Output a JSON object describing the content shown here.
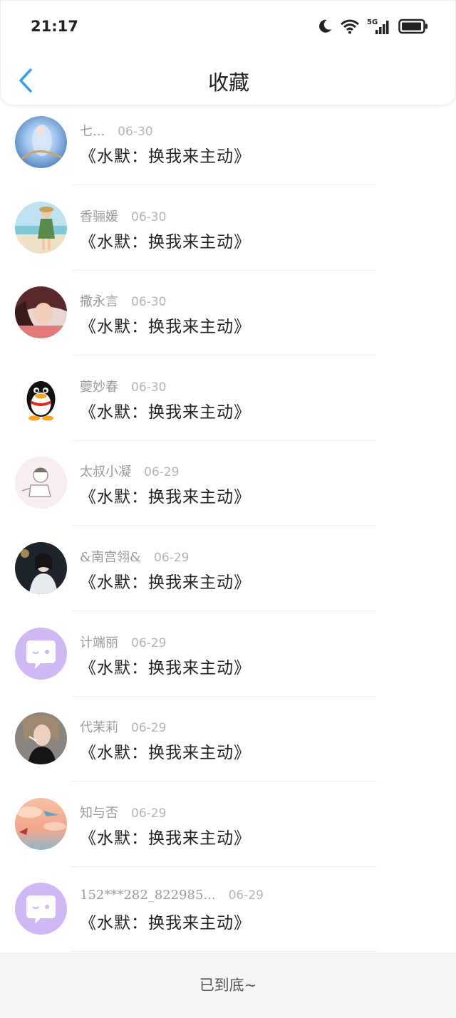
{
  "status_bar": {
    "time": "21:17",
    "icons": [
      "moon-icon",
      "wifi-icon",
      "signal-5g-icon",
      "battery-icon"
    ],
    "network_label": "5G"
  },
  "header": {
    "title": "收藏",
    "back_icon": "chevron-left-icon"
  },
  "colors": {
    "accent": "#3a9ff0",
    "name_text": "#9a9a9a",
    "date_text": "#b5b5b5",
    "footer_bg": "#f5f5f5"
  },
  "items": [
    {
      "name": "七...",
      "date": "06-30",
      "title": "《水默：换我来主动》",
      "avatar": "painting-avatar"
    },
    {
      "name": "香骊媛",
      "date": "06-30",
      "title": "《水默：换我来主动》",
      "avatar": "beach-girl-avatar"
    },
    {
      "name": "撒永言",
      "date": "06-30",
      "title": "《水默：换我来主动》",
      "avatar": "girl-portrait-avatar"
    },
    {
      "name": "夔妙春",
      "date": "06-30",
      "title": "《水默：换我来主动》",
      "avatar": "penguin-avatar"
    },
    {
      "name": "太叔小凝",
      "date": "06-29",
      "title": "《水默：换我来主动》",
      "avatar": "cartoon-boy-avatar"
    },
    {
      "name": "&南宫翎&",
      "date": "06-29",
      "title": "《水默：换我来主动》",
      "avatar": "dark-portrait-avatar"
    },
    {
      "name": "计端丽",
      "date": "06-29",
      "title": "《水默：换我来主动》",
      "avatar": "chat-bubble-avatar"
    },
    {
      "name": "代茉莉",
      "date": "06-29",
      "title": "《水默：换我来主动》",
      "avatar": "woman-smoking-avatar"
    },
    {
      "name": "知与否",
      "date": "06-29",
      "title": "《水默：换我来主动》",
      "avatar": "sunset-sky-avatar"
    },
    {
      "name": "152***282_822985...",
      "date": "06-29",
      "title": "《水默：换我来主动》",
      "avatar": "chat-bubble-avatar"
    }
  ],
  "footer": {
    "text": "已到底~"
  }
}
